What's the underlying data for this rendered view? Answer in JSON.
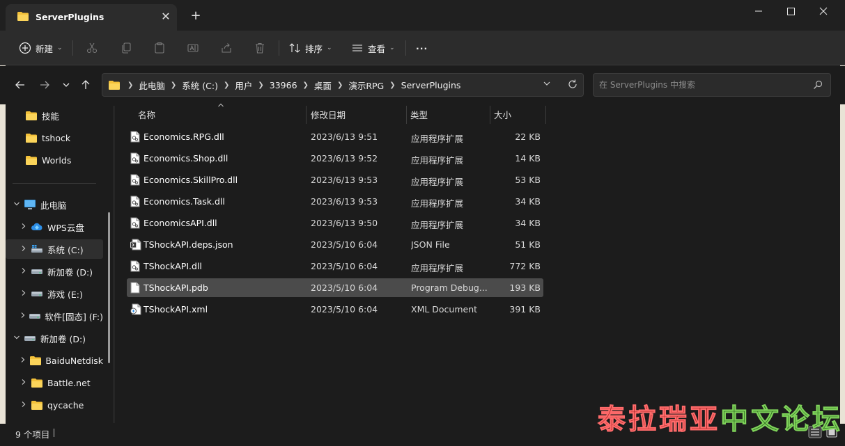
{
  "window": {
    "tab_title": "ServerPlugins",
    "tab_close_glyph": "✕",
    "new_tab_glyph": "+",
    "minimize_glyph": "—",
    "maximize_glyph": "☐",
    "close_glyph": "✕"
  },
  "toolbar": {
    "new_label": "新建",
    "sort_label": "排序",
    "view_label": "查看",
    "more_glyph": "···"
  },
  "address": {
    "crumbs": [
      "此电脑",
      "系统 (C:)",
      "用户",
      "33966",
      "桌面",
      "演示RPG",
      "ServerPlugins"
    ],
    "search_placeholder": "在 ServerPlugins 中搜索"
  },
  "sidebar": {
    "items": [
      {
        "label": "技能",
        "icon": "folder-icon"
      },
      {
        "label": "tshock",
        "icon": "folder-icon"
      },
      {
        "label": "Worlds",
        "icon": "folder-icon"
      },
      {
        "label": "此电脑",
        "icon": "computer-icon",
        "expanded": true
      },
      {
        "label": "WPS云盘",
        "icon": "cloud-icon"
      },
      {
        "label": "系统 (C:)",
        "icon": "drive-icon",
        "selected": true
      },
      {
        "label": "新加卷 (D:)",
        "icon": "drive-icon"
      },
      {
        "label": "游戏 (E:)",
        "icon": "drive-icon"
      },
      {
        "label": "软件[固态] (F:)",
        "icon": "drive-icon"
      },
      {
        "label": "新加卷 (D:)",
        "icon": "drive-icon",
        "expanded": true
      },
      {
        "label": "BaiduNetdisk",
        "icon": "folder-icon"
      },
      {
        "label": "Battle.net",
        "icon": "folder-icon"
      },
      {
        "label": "qycache",
        "icon": "folder-icon"
      }
    ]
  },
  "columns": {
    "name": "名称",
    "date": "修改日期",
    "type": "类型",
    "size": "大小"
  },
  "files": [
    {
      "name": "Economics.RPG.dll",
      "date": "2023/6/13 9:51",
      "type": "应用程序扩展",
      "size": "22 KB",
      "icon": "dll-file-icon"
    },
    {
      "name": "Economics.Shop.dll",
      "date": "2023/6/13 9:52",
      "type": "应用程序扩展",
      "size": "14 KB",
      "icon": "dll-file-icon"
    },
    {
      "name": "Economics.SkillPro.dll",
      "date": "2023/6/13 9:53",
      "type": "应用程序扩展",
      "size": "53 KB",
      "icon": "dll-file-icon"
    },
    {
      "name": "Economics.Task.dll",
      "date": "2023/6/13 9:53",
      "type": "应用程序扩展",
      "size": "34 KB",
      "icon": "dll-file-icon"
    },
    {
      "name": "EconomicsAPI.dll",
      "date": "2023/6/13 9:50",
      "type": "应用程序扩展",
      "size": "34 KB",
      "icon": "dll-file-icon"
    },
    {
      "name": "TShockAPI.deps.json",
      "date": "2023/5/10 6:04",
      "type": "JSON File",
      "size": "51 KB",
      "icon": "json-file-icon"
    },
    {
      "name": "TShockAPI.dll",
      "date": "2023/5/10 6:04",
      "type": "应用程序扩展",
      "size": "772 KB",
      "icon": "dll-file-icon"
    },
    {
      "name": "TShockAPI.pdb",
      "date": "2023/5/10 6:04",
      "type": "Program Debug...",
      "size": "193 KB",
      "icon": "blank-file-icon",
      "selected": true
    },
    {
      "name": "TShockAPI.xml",
      "date": "2023/5/10 6:04",
      "type": "XML Document",
      "size": "391 KB",
      "icon": "xml-file-icon"
    }
  ],
  "status": {
    "item_count": "9 个项目"
  },
  "watermark": {
    "text_red": "泰拉瑞亚",
    "text_green": "中文论坛"
  },
  "colors": {
    "background": "#1c1c1c",
    "toolbar": "#2c2c2c",
    "selected_row": "#4b4b4b",
    "folder": "#f3c13a",
    "drive_blue": "#3b9de8"
  }
}
